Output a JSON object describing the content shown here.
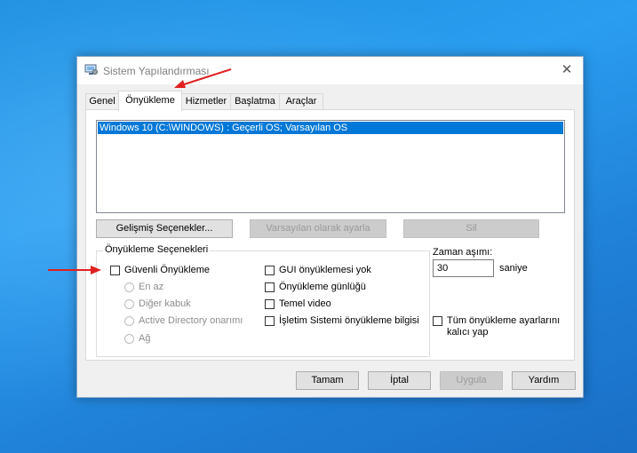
{
  "window": {
    "title": "Sistem Yapılandırması",
    "close_glyph": "✕",
    "icon": "computer-settings-icon"
  },
  "tabs": [
    {
      "label": "Genel"
    },
    {
      "label": "Önyükleme",
      "active": true
    },
    {
      "label": "Hizmetler"
    },
    {
      "label": "Başlatma"
    },
    {
      "label": "Araçlar"
    }
  ],
  "boot_list": {
    "items": [
      "Windows 10 (C:\\WINDOWS) : Geçerli OS; Varsayılan OS"
    ],
    "selected_index": 0
  },
  "buttons": {
    "advanced": "Gelişmiş Seçenekler...",
    "set_default": "Varsayılan olarak ayarla",
    "delete": "Sil"
  },
  "boot_options": {
    "group_label": "Önyükleme Seçenekleri",
    "safe_boot": {
      "label": "Güvenli Önyükleme",
      "checked": false
    },
    "safe_modes": [
      "En az",
      "Diğer kabuk",
      "Active Directory onarımı",
      "Ağ"
    ],
    "right_options": [
      {
        "label": "GUI önyüklemesi yok",
        "checked": false
      },
      {
        "label": "Önyükleme günlüğü",
        "checked": false
      },
      {
        "label": "Temel video",
        "checked": false
      },
      {
        "label": "İşletim Sistemi önyükleme bilgisi",
        "checked": false
      }
    ]
  },
  "timeout": {
    "label": "Zaman aşımı:",
    "value": "30",
    "unit": "saniye"
  },
  "permanent": {
    "line1": "Tüm önyükleme ayarlarını",
    "line2": "kalıcı yap",
    "checked": false
  },
  "footer_buttons": {
    "ok": "Tamam",
    "cancel": "İptal",
    "apply": "Uygula",
    "help": "Yardım"
  },
  "annotation_colors": {
    "arrow": "#e02020"
  },
  "colors": {
    "selection": "#0078d7",
    "desktop": "#1f86dc"
  }
}
